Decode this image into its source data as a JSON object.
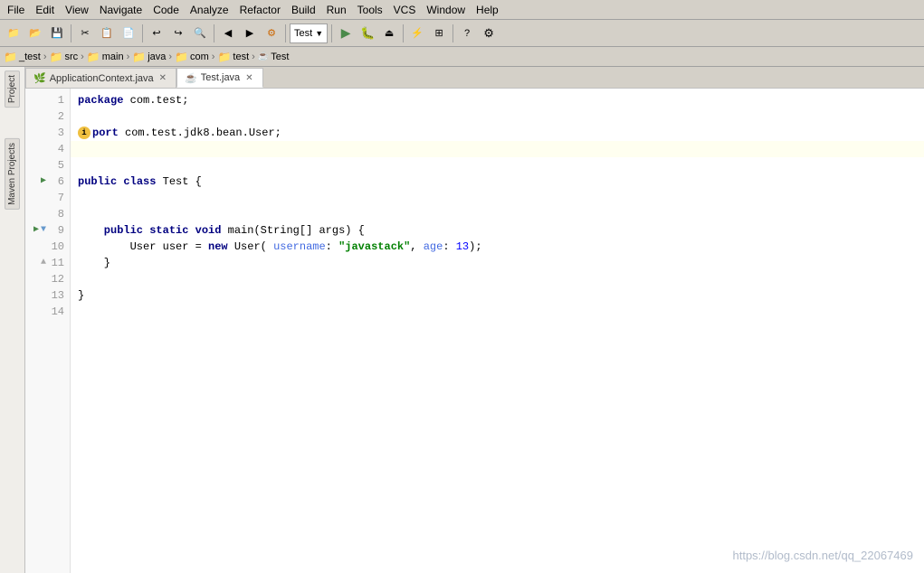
{
  "menubar": {
    "items": [
      "File",
      "Edit",
      "View",
      "Navigate",
      "Code",
      "Analyze",
      "Refactor",
      "Build",
      "Run",
      "Tools",
      "VCS",
      "Window",
      "Help"
    ]
  },
  "breadcrumb": {
    "items": [
      "_test",
      "src",
      "main",
      "java",
      "com",
      "test",
      "Test"
    ]
  },
  "tabs": [
    {
      "label": "ApplicationContext.java",
      "icon": "spring",
      "active": false,
      "closable": true
    },
    {
      "label": "Test.java",
      "icon": "java",
      "active": true,
      "closable": true
    }
  ],
  "sidebar_tabs": [
    "Project",
    "Maven Projects"
  ],
  "run_dropdown": "Test",
  "code": {
    "lines": [
      {
        "num": 1,
        "content": "package com.test;",
        "tokens": [
          {
            "type": "kw",
            "text": "package"
          },
          {
            "type": "pkg",
            "text": " com.test;"
          }
        ]
      },
      {
        "num": 2,
        "content": "",
        "tokens": []
      },
      {
        "num": 3,
        "content": "import com.test.jdk8.bean.User;",
        "tokens": [
          {
            "type": "import-icon",
            "text": "i"
          },
          {
            "type": "kw",
            "text": "port"
          },
          {
            "type": "pkg",
            "text": " com.test.jdk8.bean.User;"
          }
        ]
      },
      {
        "num": 4,
        "content": "",
        "tokens": [],
        "highlighted": true
      },
      {
        "num": 5,
        "content": "",
        "tokens": []
      },
      {
        "num": 6,
        "content": "public class Test {",
        "tokens": [
          {
            "type": "kw",
            "text": "public"
          },
          {
            "type": "plain",
            "text": " "
          },
          {
            "type": "kw",
            "text": "class"
          },
          {
            "type": "plain",
            "text": " Test {"
          }
        ],
        "runnable": true
      },
      {
        "num": 7,
        "content": "",
        "tokens": []
      },
      {
        "num": 8,
        "content": "",
        "tokens": []
      },
      {
        "num": 9,
        "content": "    public static void main(String[] args) {",
        "tokens": [
          {
            "type": "kw",
            "text": "    public"
          },
          {
            "type": "plain",
            "text": " "
          },
          {
            "type": "kw",
            "text": "static"
          },
          {
            "type": "plain",
            "text": " "
          },
          {
            "type": "kw",
            "text": "void"
          },
          {
            "type": "plain",
            "text": " main(String[] args) {"
          }
        ],
        "runnable": true,
        "foldable": true
      },
      {
        "num": 10,
        "content": "        User user = new User( username: \"javastack\", age: 13);",
        "tokens": [
          {
            "type": "plain",
            "text": "        User "
          },
          {
            "type": "plain",
            "text": "user"
          },
          {
            "type": "plain",
            "text": " = "
          },
          {
            "type": "kw",
            "text": "new"
          },
          {
            "type": "plain",
            "text": " User( "
          },
          {
            "type": "param-name",
            "text": "username"
          },
          {
            "type": "plain",
            "text": ": "
          },
          {
            "type": "str",
            "text": "\"javastack\""
          },
          {
            "type": "plain",
            "text": ", "
          },
          {
            "type": "param-name",
            "text": "age"
          },
          {
            "type": "plain",
            "text": ": "
          },
          {
            "type": "num",
            "text": "13"
          },
          {
            "type": "plain",
            "text": ");"
          }
        ]
      },
      {
        "num": 11,
        "content": "    }",
        "tokens": [
          {
            "type": "plain",
            "text": "    }"
          }
        ],
        "foldable-end": true
      },
      {
        "num": 12,
        "content": "",
        "tokens": []
      },
      {
        "num": 13,
        "content": "}",
        "tokens": [
          {
            "type": "plain",
            "text": "}"
          }
        ]
      },
      {
        "num": 14,
        "content": "",
        "tokens": []
      }
    ]
  },
  "watermark": "https://blog.csdn.net/qq_22067469"
}
